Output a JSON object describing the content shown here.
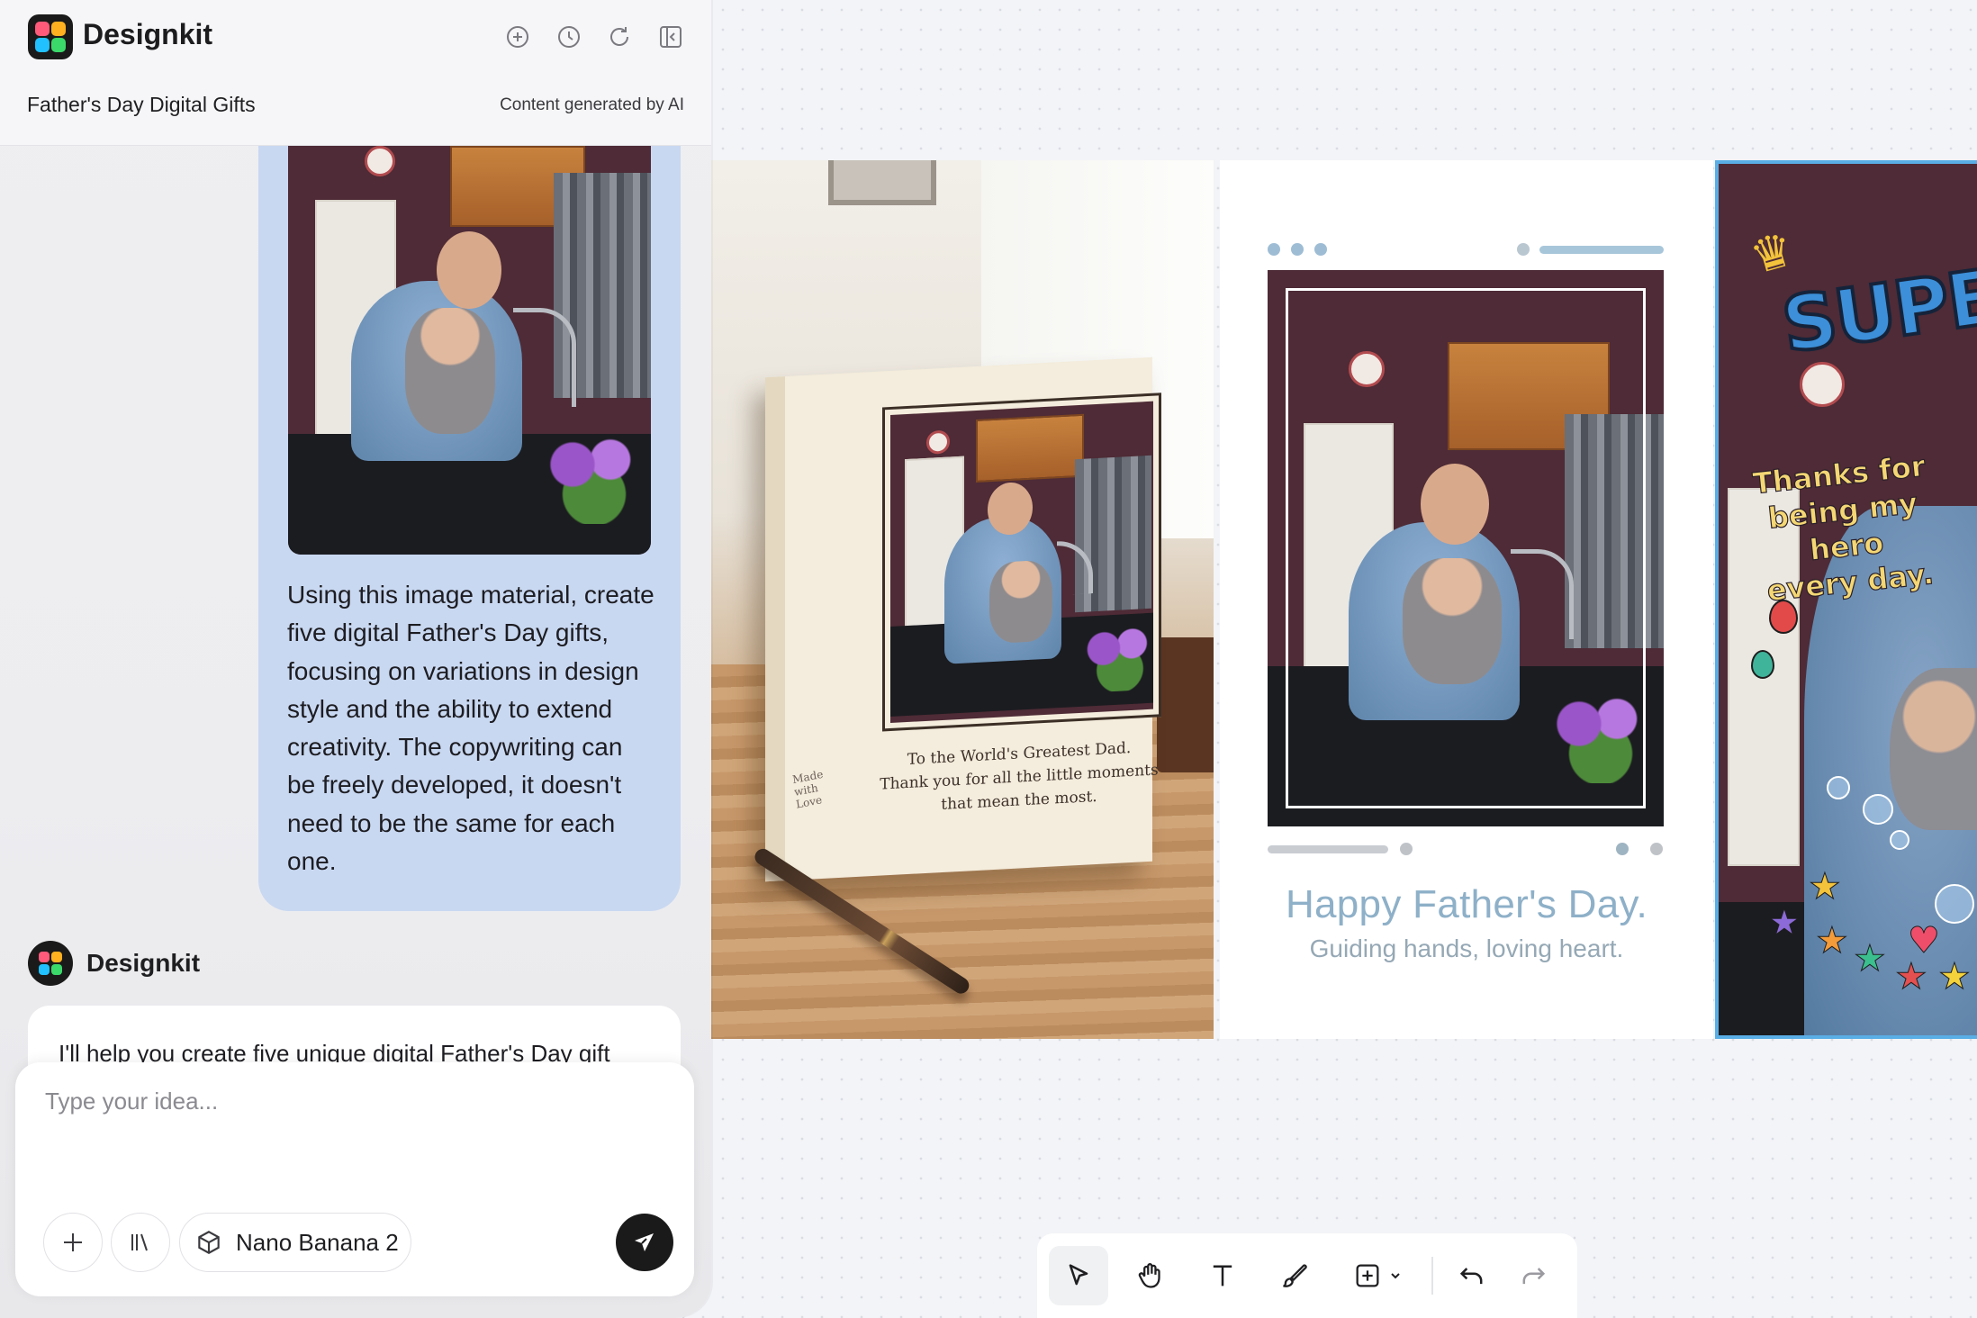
{
  "app": {
    "name": "Designkit"
  },
  "header": {
    "project_title": "Father's Day Digital Gifts",
    "ai_note": "Content generated by AI",
    "icons": [
      "add-chat-icon",
      "history-icon",
      "refresh-icon",
      "collapse-panel-icon"
    ]
  },
  "chat": {
    "user_message": "Using this image material, create five digital Father's Day gifts, focusing on variations in design style and the ability to extend creativity. The copywriting can be freely developed, it doesn't need to be the same for each one.",
    "assistant_name": "Designkit",
    "assistant_message": "I'll help you create five unique digital Father's Day gift"
  },
  "composer": {
    "placeholder": "Type your idea...",
    "model": "Nano Banana 2"
  },
  "canvas": {
    "card1": {
      "message_lines": [
        "To the World's Greatest Dad.",
        "Thank you for all the little moments",
        "that mean the most."
      ],
      "made_with_love": "Made with Love"
    },
    "card2": {
      "title": "Happy Father's Day.",
      "subtitle": "Guiding hands, loving heart."
    },
    "card3": {
      "headline": "SUPER",
      "thanks_lines": [
        "Thanks for",
        "being my hero",
        "every day."
      ]
    }
  },
  "toolbar": {
    "tools": [
      "select-tool",
      "hand-tool",
      "text-tool",
      "brush-tool",
      "insert-tool",
      "undo",
      "redo"
    ],
    "active": "select-tool"
  },
  "colors": {
    "accent_selection": "#5aaee6",
    "user_bubble": "#c9d8f1",
    "card2_title": "#8eb0c8"
  }
}
